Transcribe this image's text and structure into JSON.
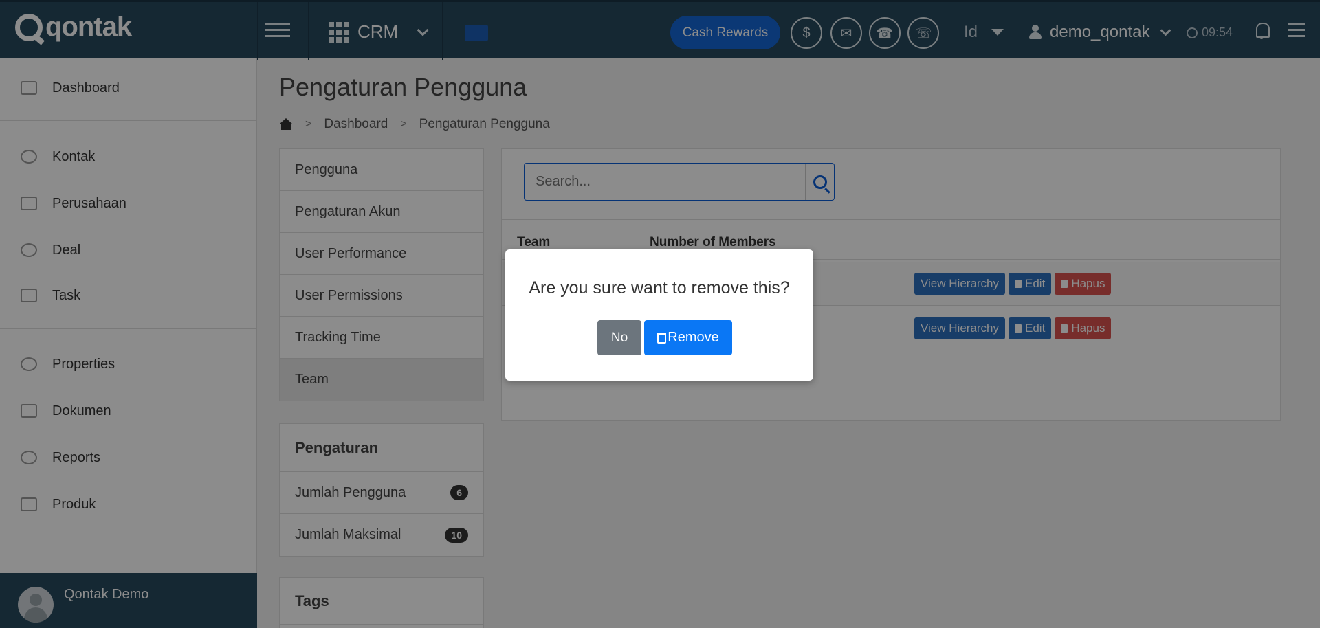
{
  "header": {
    "logo_text": "qontak",
    "module": "CRM",
    "cash_rewards": "Cash Rewards",
    "language": "Id",
    "username": "demo_qontak",
    "time": "09:54"
  },
  "sidebar": {
    "items": [
      {
        "label": "Dashboard",
        "icon": "home-icon"
      },
      {
        "label": "Kontak",
        "icon": "contacts-icon"
      },
      {
        "label": "Perusahaan",
        "icon": "building-icon"
      },
      {
        "label": "Deal",
        "icon": "dollar-icon"
      },
      {
        "label": "Task",
        "icon": "calendar-icon"
      },
      {
        "label": "Properties",
        "icon": "list-icon"
      },
      {
        "label": "Dokumen",
        "icon": "layers-icon"
      },
      {
        "label": "Reports",
        "icon": "pie-chart-icon"
      },
      {
        "label": "Produk",
        "icon": "tag-icon"
      }
    ],
    "footer_name": "Qontak Demo"
  },
  "page": {
    "title": "Pengaturan Pengguna",
    "breadcrumb": [
      "Dashboard",
      "Pengaturan Pengguna"
    ]
  },
  "settings_menu": {
    "items": [
      "Pengguna",
      "Pengaturan Akun",
      "User Performance",
      "User Permissions",
      "Tracking Time",
      "Team"
    ],
    "active": "Team"
  },
  "pengaturan_panel": {
    "title": "Pengaturan",
    "rows": [
      {
        "label": "Jumlah Pengguna",
        "count": "6"
      },
      {
        "label": "Jumlah Maksimal",
        "count": "10"
      }
    ]
  },
  "tags_panel": {
    "title": "Tags"
  },
  "search": {
    "placeholder": "Search..."
  },
  "table": {
    "columns": [
      "Team",
      "Number of Members"
    ],
    "actions": {
      "view": "View Hierarchy",
      "edit": "Edit",
      "delete": "Hapus"
    }
  },
  "modal": {
    "message": "Are you sure want to remove this?",
    "no_label": "No",
    "remove_label": "Remove"
  },
  "colors": {
    "topbar": "#27495e",
    "primary": "#0a77f5",
    "danger": "#d9534f"
  }
}
